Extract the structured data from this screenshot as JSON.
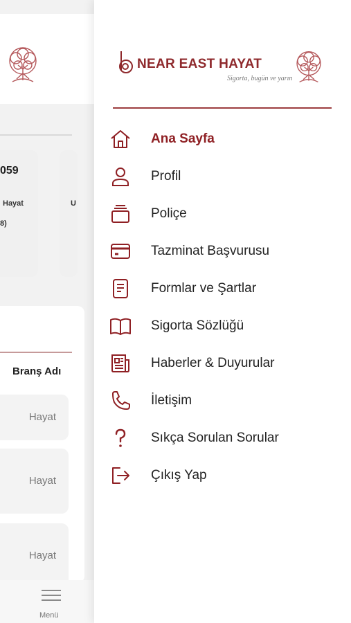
{
  "background": {
    "policy_number_fragment": "059",
    "card_branch_text": "Hayat",
    "card_paren_text": "8)",
    "card2_fragment": "U",
    "table_column_title": "Branş Adı",
    "rows": [
      "Hayat",
      "Hayat",
      "Hayat"
    ],
    "tab_menu_label": "Menü"
  },
  "drawer": {
    "brand_name": "NEAR EAST HAYAT",
    "brand_tagline": "Sigorta, bugün ve yarın",
    "items": [
      {
        "label": "Ana Sayfa",
        "icon": "home-icon",
        "active": true
      },
      {
        "label": "Profil",
        "icon": "user-icon",
        "active": false
      },
      {
        "label": "Poliçe",
        "icon": "policy-icon",
        "active": false
      },
      {
        "label": "Tazminat Başvurusu",
        "icon": "credit-card-icon",
        "active": false
      },
      {
        "label": "Formlar ve Şartlar",
        "icon": "document-icon",
        "active": false
      },
      {
        "label": "Sigorta Sözlüğü",
        "icon": "book-icon",
        "active": false
      },
      {
        "label": "Haberler & Duyurular",
        "icon": "newspaper-icon",
        "active": false
      },
      {
        "label": "İletişim",
        "icon": "phone-icon",
        "active": false
      },
      {
        "label": "Sıkça Sorulan Sorular",
        "icon": "question-icon",
        "active": false
      },
      {
        "label": "Çıkış Yap",
        "icon": "logout-icon",
        "active": false
      }
    ]
  },
  "colors": {
    "brand": "#8f2a2d",
    "icon": "#8f2024"
  }
}
